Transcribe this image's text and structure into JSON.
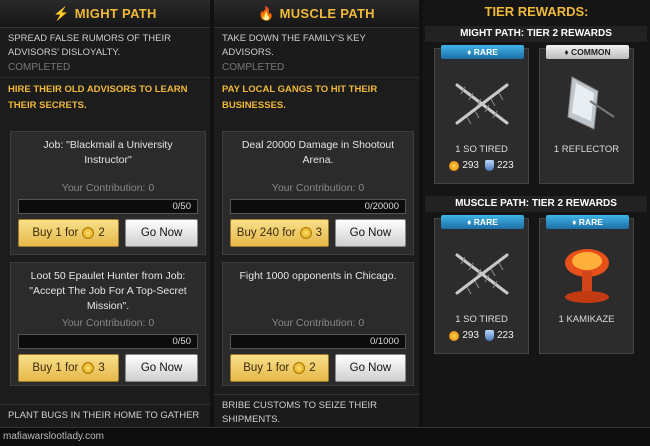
{
  "might": {
    "header": "MIGHT PATH",
    "done_task": "SPREAD FALSE RUMORS OF THEIR ADVISORS' DISLOYALTY.",
    "done_status": "COMPLETED",
    "open_task": "HIRE THEIR OLD ADVISORS TO LEARN THEIR SECRETS.",
    "jobs": [
      {
        "name": "Job: \"Blackmail a University Instructor\"",
        "contribution": "Your Contribution: 0",
        "progress": "0/50",
        "progress_fraction": 0,
        "buy_prefix": "Buy 1 for",
        "buy_cost": "2",
        "go": "Go Now"
      },
      {
        "name": "Loot 50 Epaulet Hunter from Job: \"Accept The Job For A Top-Secret Mission\".",
        "contribution": "Your Contribution: 0",
        "progress": "0/50",
        "progress_fraction": 0,
        "buy_prefix": "Buy 1 for",
        "buy_cost": "3",
        "go": "Go Now"
      }
    ],
    "next_task": "PLANT BUGS IN THEIR HOME TO GATHER"
  },
  "muscle": {
    "header": "MUSCLE PATH",
    "done_task": "TAKE DOWN THE FAMILY'S KEY ADVISORS.",
    "done_status": "COMPLETED",
    "open_task": "PAY LOCAL GANGS TO HIT THEIR BUSINESSES.",
    "jobs": [
      {
        "name": "Deal 20000 Damage in Shootout Arena.",
        "contribution": "Your Contribution: 0",
        "progress": "0/20000",
        "progress_fraction": 0,
        "buy_prefix": "Buy 240 for",
        "buy_cost": "3",
        "go": "Go Now"
      },
      {
        "name": "Fight 1000 opponents in Chicago.",
        "contribution": "Your Contribution: 0",
        "progress": "0/1000",
        "progress_fraction": 0,
        "buy_prefix": "Buy 1 for",
        "buy_cost": "2",
        "go": "Go Now"
      }
    ],
    "next_task": "BRIBE CUSTOMS TO SEIZE THEIR SHIPMENTS."
  },
  "tiers": {
    "title": "TIER REWARDS:",
    "might_header": "MIGHT PATH: TIER 2 REWARDS",
    "muscle_header": "MUSCLE PATH: TIER 2 REWARDS",
    "might_rewards": [
      {
        "rarity": "RARE",
        "name": "1 SO TIRED",
        "attack": "293",
        "defense": "223",
        "icon": "crossed-spikes-icon"
      },
      {
        "rarity": "COMMON",
        "name": "1 REFLECTOR",
        "attack": "",
        "defense": "",
        "icon": "reflector-icon"
      }
    ],
    "muscle_rewards": [
      {
        "rarity": "RARE",
        "name": "1 SO TIRED",
        "attack": "293",
        "defense": "223",
        "icon": "crossed-spikes-icon"
      },
      {
        "rarity": "RARE",
        "name": "1 KAMIKAZE",
        "attack": "",
        "defense": "",
        "icon": "explosion-icon"
      }
    ]
  },
  "footer": {
    "watermark": "mafiawarslootlady.com"
  },
  "colors": {
    "accent": "#f0b93a",
    "rare": "#2f9bd6",
    "common": "#d8d8d8",
    "buy": "#f0c85a"
  }
}
